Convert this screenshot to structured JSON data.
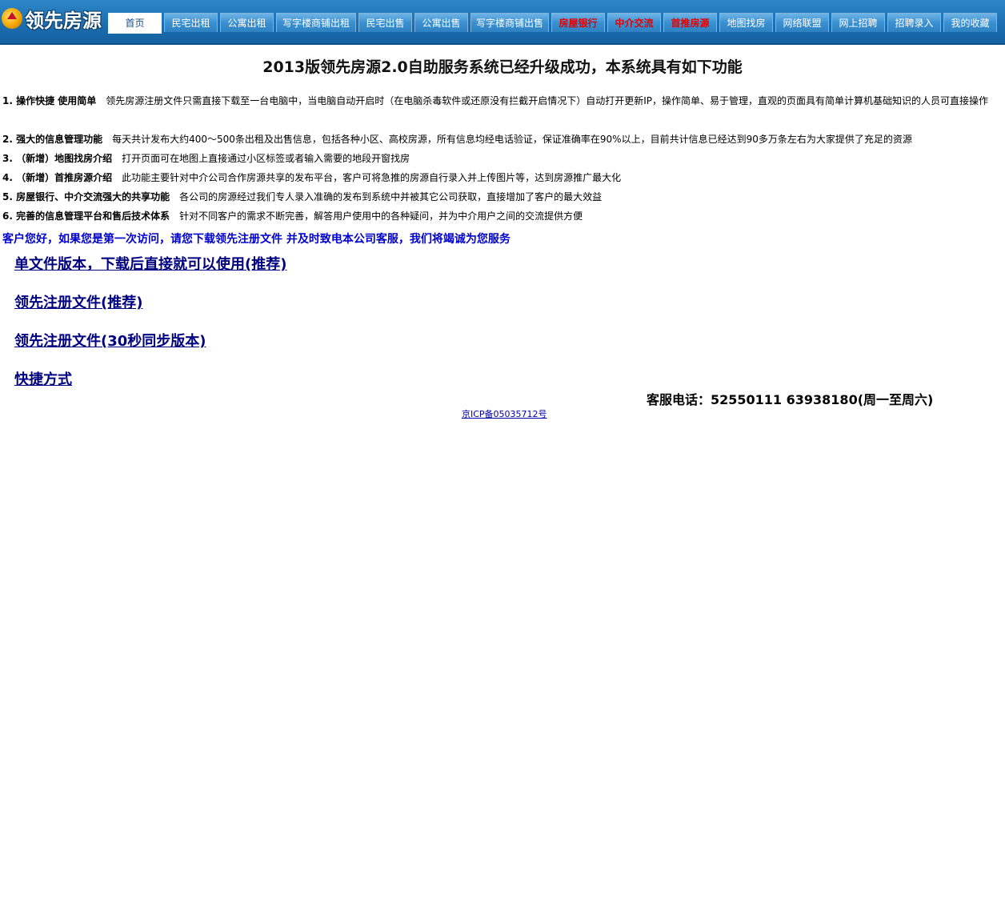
{
  "header": {
    "logo_text": "领先房源",
    "nav": [
      {
        "label": "首页",
        "active": true,
        "hot": false
      },
      {
        "label": "民宅出租",
        "active": false,
        "hot": false
      },
      {
        "label": "公寓出租",
        "active": false,
        "hot": false
      },
      {
        "label": "写字楼商铺出租",
        "active": false,
        "hot": false
      },
      {
        "label": "民宅出售",
        "active": false,
        "hot": false
      },
      {
        "label": "公寓出售",
        "active": false,
        "hot": false
      },
      {
        "label": "写字楼商铺出售",
        "active": false,
        "hot": false
      },
      {
        "label": "房屋银行",
        "active": false,
        "hot": true
      },
      {
        "label": "中介交流",
        "active": false,
        "hot": true
      },
      {
        "label": "首推房源",
        "active": false,
        "hot": true
      },
      {
        "label": "地图找房",
        "active": false,
        "hot": false
      },
      {
        "label": "网络联盟",
        "active": false,
        "hot": false
      },
      {
        "label": "网上招聘",
        "active": false,
        "hot": false
      },
      {
        "label": "招聘录入",
        "active": false,
        "hot": false
      },
      {
        "label": "我的收藏",
        "active": false,
        "hot": false
      }
    ]
  },
  "main": {
    "title": "2013版领先房源2.0自助服务系统已经升级成功，本系统具有如下功能",
    "features": [
      {
        "heading": "1. 操作快捷 使用简单",
        "text": "领先房源注册文件只需直接下载至一台电脑中，当电脑自动开启时（在电脑杀毒软件或还原没有拦截开启情况下）自动打开更新IP，操作简单、易于管理，直观的页面具有简单计算机基础知识的人员可直接操作"
      },
      {
        "heading": "2. 强大的信息管理功能",
        "text": "每天共计发布大约400～500条出租及出售信息，包括各种小区、高校房源，所有信息均经电话验证，保证准确率在90%以上，目前共计信息已经达到90多万条左右为大家提供了充足的资源"
      },
      {
        "heading": "3. （新增）地图找房介绍",
        "text": "打开页面可在地图上直接通过小区标签或者输入需要的地段开窗找房"
      },
      {
        "heading": "4. （新增）首推房源介绍",
        "text": "此功能主要针对中介公司合作房源共享的发布平台，客户可将急推的房源自行录入并上传图片等，达到房源推广最大化"
      },
      {
        "heading": "5. 房屋银行、中介交流强大的共享功能",
        "text": "各公司的房源经过我们专人录入准确的发布到系统中并被其它公司获取，直接增加了客户的最大效益"
      },
      {
        "heading": "6. 完善的信息管理平台和售后技术体系",
        "text": "针对不同客户的需求不断完善，解答用户使用中的各种疑问，并为中介用户之间的交流提供方便"
      }
    ],
    "notice": "客户您好，如果您是第一次访问，请您下载领先注册文件 并及时致电本公司客服，我们将竭诚为您服务",
    "downloads": [
      "单文件版本，下载后直接就可以使用(推荐)",
      "领先注册文件(推荐)",
      "领先注册文件(30秒同步版本)",
      "快捷方式"
    ],
    "phone": "客服电话：52550111  63938180(周一至周六)",
    "icp": "京ICP备05035712号"
  }
}
